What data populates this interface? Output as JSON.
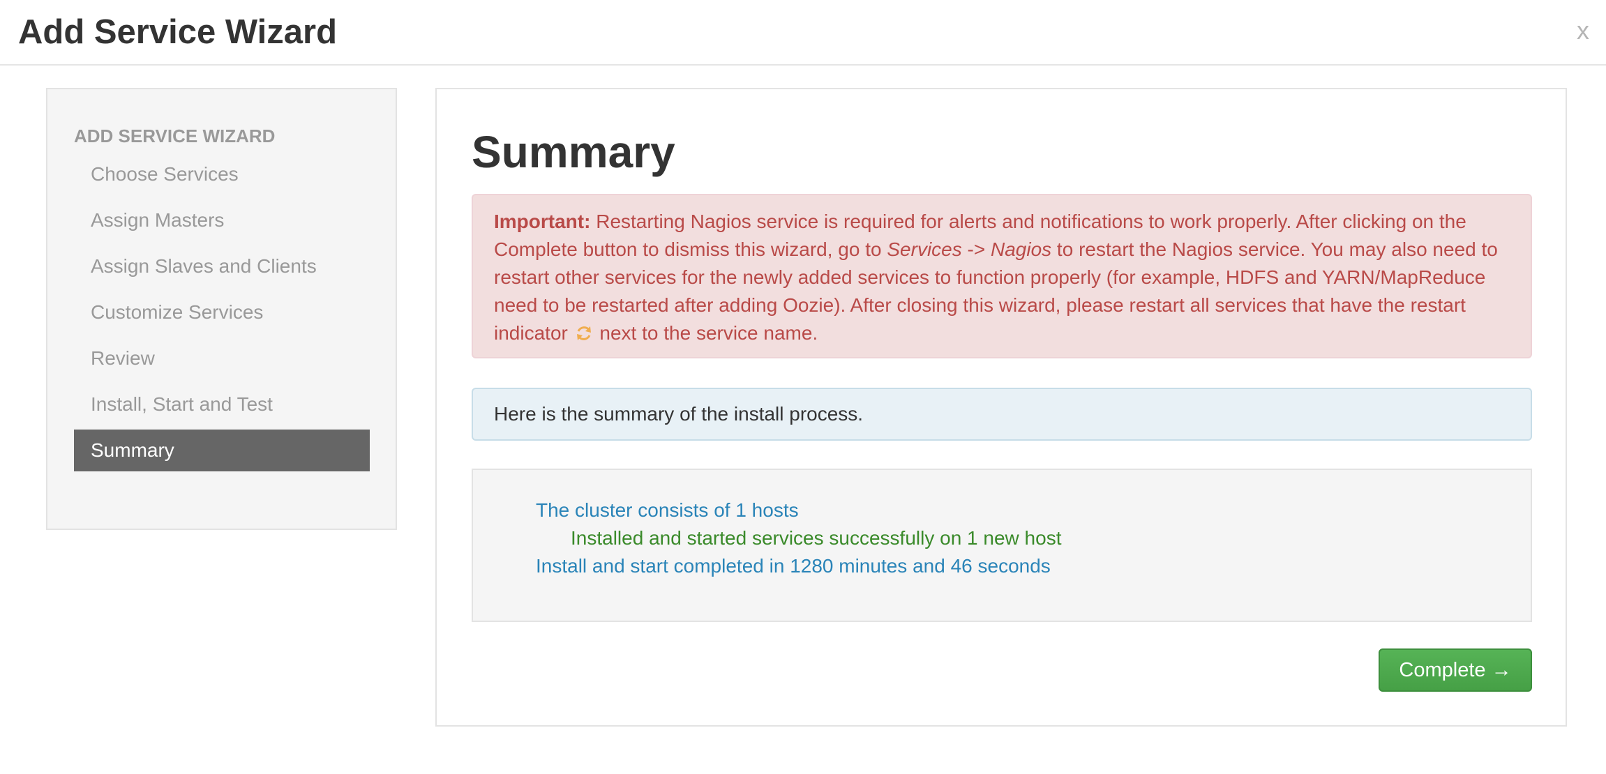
{
  "modal": {
    "title": "Add Service Wizard",
    "close_label": "x"
  },
  "sidebar": {
    "header": "ADD SERVICE WIZARD",
    "items": [
      {
        "label": "Choose Services",
        "active": false
      },
      {
        "label": "Assign Masters",
        "active": false
      },
      {
        "label": "Assign Slaves and Clients",
        "active": false
      },
      {
        "label": "Customize Services",
        "active": false
      },
      {
        "label": "Review",
        "active": false
      },
      {
        "label": "Install, Start and Test",
        "active": false
      },
      {
        "label": "Summary",
        "active": true
      }
    ]
  },
  "main": {
    "title": "Summary",
    "alert_error": {
      "prefix": "Important:",
      "text_1": " Restarting Nagios service is required for alerts and notifications to work properly. After clicking on the Complete button to dismiss this wizard, go to ",
      "services_link": "Services",
      "arrow": " -> ",
      "nagios_link": "Nagios",
      "text_2": " to restart the Nagios service. You may also need to restart other services for the newly added services to function properly (for example, HDFS and YARN/MapReduce need to be restarted after adding Oozie). After closing this wizard, please restart all services that have the restart indicator ",
      "icon": "refresh-icon",
      "text_3": " next to the service name."
    },
    "alert_info": "Here is the summary of the install process.",
    "summary": {
      "cluster_hosts": "The cluster consists of 1 hosts",
      "installed_status": "Installed and started services successfully on 1 new host",
      "duration": "Install and start completed in 1280 minutes and 46 seconds"
    },
    "complete_button": "Complete →"
  },
  "colors": {
    "error_text": "#b94a48",
    "error_bg": "#f2dede",
    "info_bg": "#e8f1f6",
    "summary_blue": "#2a84b8",
    "summary_green": "#3a8a2a",
    "button_green": "#4cab4c",
    "active_item_bg": "#666666",
    "refresh_icon": "#f0ad4e"
  }
}
